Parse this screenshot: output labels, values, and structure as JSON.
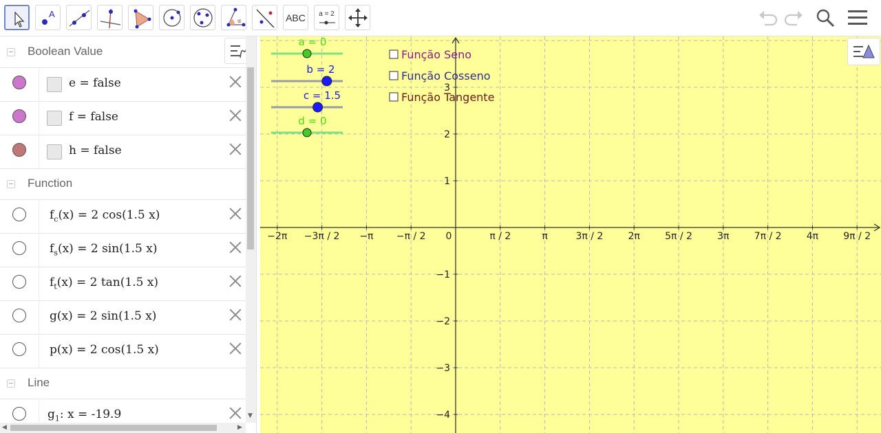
{
  "toolbar": {
    "tools": [
      "move",
      "point",
      "line",
      "perpendicular-line",
      "polygon",
      "circle",
      "conic",
      "angle",
      "reflect",
      "text",
      "slider",
      "move-graphics-view"
    ],
    "text_label": "ABC",
    "slider_label": "a = 2",
    "selected": "move"
  },
  "algebra": {
    "sections": [
      {
        "title": "Boolean Value"
      },
      {
        "title": "Function"
      },
      {
        "title": "Line"
      }
    ],
    "booleans": [
      {
        "name": "e",
        "rest": " = false",
        "color": "#cc77cc"
      },
      {
        "name": "f",
        "rest": " = false",
        "color": "#cc77cc"
      },
      {
        "name": "h",
        "rest": " = false",
        "color": "#c07777"
      }
    ],
    "functions": [
      {
        "name": "f",
        "sub": "c",
        "rest": "(x) = 2 cos(1.5 x)"
      },
      {
        "name": "f",
        "sub": "s",
        "rest": "(x) = 2 sin(1.5 x)"
      },
      {
        "name": "f",
        "sub": "t",
        "rest": "(x) = 2 tan(1.5 x)"
      },
      {
        "name": "g",
        "sub": "",
        "rest": "(x) = 2 sin(1.5 x)"
      },
      {
        "name": "p",
        "sub": "",
        "rest": "(x) = 2 cos(1.5 x)"
      }
    ],
    "lines": [
      {
        "name": "g",
        "sub": "1",
        "rest": ": x = -19.9"
      }
    ]
  },
  "graphics": {
    "background": "#ffff99",
    "grid_color": "#b8b8b8",
    "x_ticks": [
      "−2π",
      "−3π / 2",
      "−π",
      "−π / 2",
      "0",
      "π / 2",
      "π",
      "3π / 2",
      "2π",
      "5π / 2",
      "3π",
      "7π / 2",
      "4π",
      "9π / 2"
    ],
    "y_ticks": [
      "3",
      "2",
      "1",
      "−1",
      "−2",
      "−3",
      "−4"
    ],
    "sliders": [
      {
        "label": "a = 0",
        "value": 0,
        "min": -5,
        "max": 5,
        "color": "#44cc22",
        "text_color": "#44dd11"
      },
      {
        "label": "b = 2",
        "value": 2,
        "min": -5,
        "max": 5,
        "color": "#1a1aff",
        "text_color": "#1a1adf"
      },
      {
        "label": "c = 1.5",
        "value": 1.5,
        "min": -5,
        "max": 5,
        "color": "#1a1aff",
        "text_color": "#1a1adf"
      },
      {
        "label": "d = 0",
        "value": 0,
        "min": -5,
        "max": 5,
        "color": "#44cc22",
        "text_color": "#44dd11"
      }
    ],
    "checkboxes": [
      {
        "label": "Função Seno",
        "color": "#8b1a8b"
      },
      {
        "label": "Função Cosseno",
        "color": "#2d2d8b"
      },
      {
        "label": "Função Tangente",
        "color": "#6b1a1a"
      }
    ]
  }
}
